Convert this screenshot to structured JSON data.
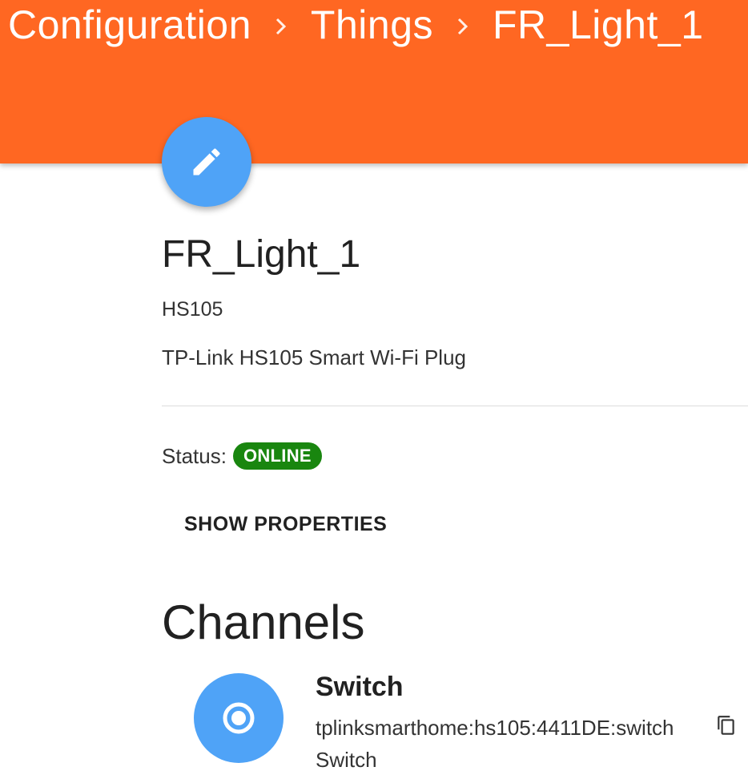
{
  "header": {
    "breadcrumb": [
      {
        "label": "Configuration"
      },
      {
        "label": "Things"
      },
      {
        "label": "FR_Light_1"
      }
    ],
    "background_color": "#ff6722"
  },
  "edit_button": {
    "icon": "pencil-icon",
    "color": "#4fa3f7"
  },
  "thing": {
    "title": "FR_Light_1",
    "model": "HS105",
    "description": "TP-Link HS105 Smart Wi-Fi Plug"
  },
  "status": {
    "label": "Status:",
    "value": "ONLINE",
    "color": "#19860f"
  },
  "show_properties_label": "SHOW PROPERTIES",
  "channels": {
    "title": "Channels",
    "items": [
      {
        "name": "Switch",
        "uid": "tplinksmarthome:hs105:4411DE:switch",
        "type": "Switch",
        "icon": "radio-button-icon"
      }
    ]
  }
}
